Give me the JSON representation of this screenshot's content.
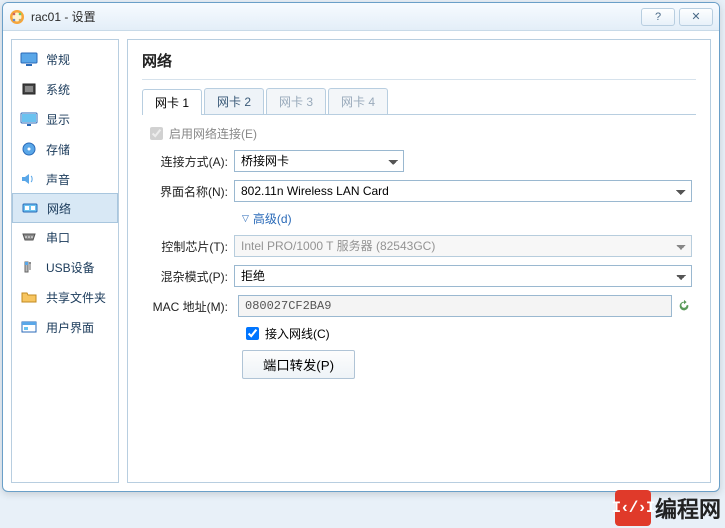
{
  "window": {
    "title": "rac01 - 设置",
    "help_hint": "?",
    "close_hint": "✕"
  },
  "sidebar": {
    "items": [
      {
        "label": "常规"
      },
      {
        "label": "系统"
      },
      {
        "label": "显示"
      },
      {
        "label": "存储"
      },
      {
        "label": "声音"
      },
      {
        "label": "网络"
      },
      {
        "label": "串口"
      },
      {
        "label": "USB设备"
      },
      {
        "label": "共享文件夹"
      },
      {
        "label": "用户界面"
      }
    ]
  },
  "content": {
    "title": "网络",
    "tabs": [
      {
        "label": "网卡 1"
      },
      {
        "label": "网卡 2"
      },
      {
        "label": "网卡 3"
      },
      {
        "label": "网卡 4"
      }
    ],
    "enable_label": "启用网络连接(E)",
    "attach_label": "连接方式(A):",
    "attach_value": "桥接网卡",
    "interface_label": "界面名称(N):",
    "interface_value": "802.11n Wireless LAN Card",
    "advanced_label": "高级(d)",
    "chipset_label": "控制芯片(T):",
    "chipset_value": "Intel PRO/1000 T 服务器 (82543GC)",
    "promisc_label": "混杂模式(P):",
    "promisc_value": "拒绝",
    "mac_label": "MAC 地址(M):",
    "mac_value": "080027CF2BA9",
    "cable_label": "接入网线(C)",
    "portfwd_label": "端口转发(P)"
  },
  "watermark": {
    "code": "I‹/›I",
    "text": "编程网"
  }
}
